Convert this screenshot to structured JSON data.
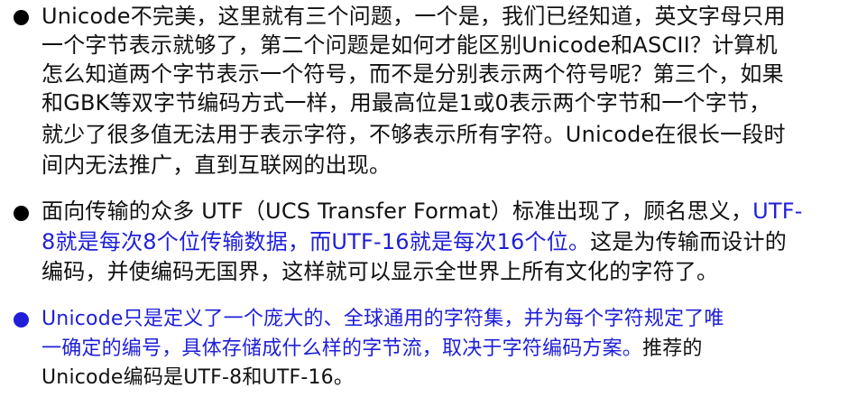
{
  "bullets": [
    {
      "lines": [
        "Unicode不完美，这里就有三个问题，一个是，我们已经知道，英文字母只用",
        "一个字节表示就够了，第二个问题是如何才能区别Unicode和ASCII？计算机",
        "怎么知道两个字节表示一个符号，而不是分别表示两个符号呢？第三个，如果",
        "和GBK等双字节编码方式一样，用最高位是1或0表示两个字节和一个字节，",
        "就少了很多值无法用于表示字符，不够表示所有字符。Unicode在很长一段时",
        "间内无法推广，直到互联网的出现。"
      ]
    },
    {
      "line1_black": "面向传输的众多 UTF（UCS Transfer Format）标准出现了，顾名思义，",
      "line1_blue": "UTF-",
      "line2_blue": "8就是每次8个位传输数据，而UTF-16就是每次16个位。",
      "line2_black": "这是为传输而设计的",
      "line3": "编码，并使编码无国界，这样就可以显示全世界上所有文化的字符了。"
    },
    {
      "line1_blue": "Unicode只是定义了一个庞大的、全球通用的字符集，并为每个字符规定了唯",
      "line2_blue": "一确定的编号，具体存储成什么样的字节流，取决于字符编码方案。",
      "line2_black": "推荐的",
      "line3": "Unicode编码是UTF-8和UTF-16。"
    }
  ],
  "colors": {
    "text": "#111111",
    "accent_blue": "#1f1fd8"
  }
}
